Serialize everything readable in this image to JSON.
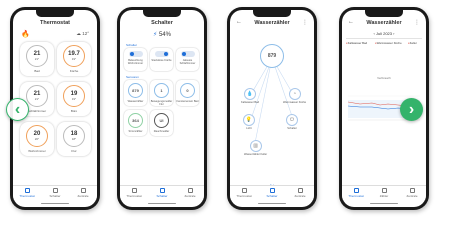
{
  "phone1": {
    "title": "Thermostat",
    "outdoor": "12°",
    "cards": [
      {
        "value": "21",
        "unit": "°C",
        "sub": "21°",
        "label": "Bad",
        "color": "blue"
      },
      {
        "value": "19.7",
        "unit": "°C",
        "sub": "19°",
        "label": "Küche",
        "color": "orange"
      },
      {
        "value": "21",
        "unit": "°C",
        "sub": "21°",
        "label": "Schlafzimmer",
        "color": "blue"
      },
      {
        "value": "19",
        "unit": "°C",
        "sub": "19°",
        "label": "Büro",
        "color": "orange"
      },
      {
        "value": "20",
        "unit": "°C",
        "sub": "20°",
        "label": "Wohnzimmer",
        "color": "orange"
      },
      {
        "value": "18",
        "unit": "°C",
        "sub": "18°",
        "label": "Flur",
        "color": "blue"
      }
    ],
    "tabs": [
      "Thermostat",
      "Schalter",
      "Zentrale"
    ]
  },
  "phone2": {
    "title": "Schalter",
    "value": "54%",
    "section1": "Schalter",
    "section2": "Sensoren",
    "tiles_row1": [
      {
        "label": "Beleuchtung Wohnzimmer",
        "on": false
      },
      {
        "label": "Steckdose Küche",
        "on": true
      },
      {
        "label": "Jalousie Schlafzimmer",
        "on": false
      }
    ],
    "tiles_row2": [
      {
        "value": "879",
        "label": "Wasserzähler",
        "ring": "blue"
      },
      {
        "value": "1",
        "label": "Bewegungsmelder Flur",
        "ring": "blue"
      },
      {
        "value": "0",
        "label": "Fenstersensor Bad",
        "ring": "blue"
      }
    ],
    "tiles_row3": [
      {
        "value": "364",
        "label": "Stromzähler",
        "ring": "green"
      },
      {
        "value": "UI",
        "label": "Rauchmelder",
        "ring": "dark"
      }
    ],
    "tabs": [
      "Thermostat",
      "Schalter",
      "Zentrale"
    ]
  },
  "phone3": {
    "title": "Wasserzähler",
    "center_value": "879",
    "nodes": [
      {
        "icon": "💧",
        "label": "Kaltwasser Bad"
      },
      {
        "icon": "◔",
        "label": "Warmwasser Küche"
      },
      {
        "icon": "💡",
        "label": "Licht"
      },
      {
        "icon": "⏻",
        "label": "Schalter"
      },
      {
        "icon": "▥",
        "label": "Wasserzähler Keller"
      }
    ],
    "tabs": [
      "Thermostat",
      "Schalter",
      "Zentrale"
    ]
  },
  "phone4": {
    "title": "Wasserzähler",
    "date": "Juli 2023",
    "chips": [
      "Kaltwasser Bad",
      "Warmwasser Küche",
      "Keller"
    ],
    "chart_title": "Verbrauch",
    "tabs": [
      "Thermostat",
      "Zähler",
      "Zentrale"
    ]
  },
  "arrows": {
    "left": "‹",
    "right": "›"
  }
}
